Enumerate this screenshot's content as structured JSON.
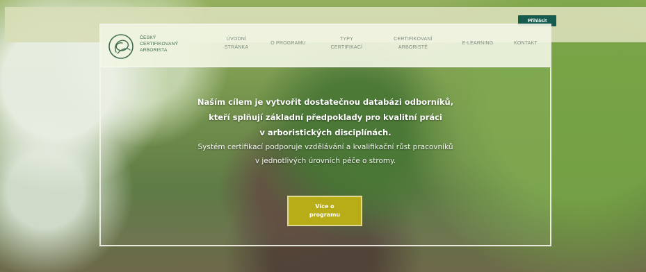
{
  "topbar": {
    "login_label": "Přihlásit"
  },
  "brand": {
    "line1": "Český",
    "line2": "certifikovaný",
    "line3": "arborista"
  },
  "nav": [
    {
      "line1": "Úvodní",
      "line2": "stránka"
    },
    {
      "line1": "O programu",
      "line2": ""
    },
    {
      "line1": "Typy",
      "line2": "certifikací"
    },
    {
      "line1": "Certifikovaní",
      "line2": "arboristé"
    },
    {
      "line1": "E-learning",
      "line2": ""
    },
    {
      "line1": "Kontakt",
      "line2": ""
    }
  ],
  "hero": {
    "title_lines": [
      "Naším cílem je vytvořit dostatečnou databázi odborníků,",
      "kteří splňují základní předpoklady pro kvalitní práci",
      "v arboristických disciplínách."
    ],
    "subtitle_lines": [
      "Systém certifikací podporuje vzdělávání a kvalifikační růst pracovníků",
      "v jednotlivých úrovních péče o stromy."
    ]
  },
  "cta": {
    "line1": "Více o",
    "line2": "programu"
  },
  "colors": {
    "accent": "#155c4f",
    "cta": "#b8ad17",
    "header_bg": "#f0f4e2"
  },
  "icons": {
    "logo": "intertwined-leaves-logo-icon"
  }
}
